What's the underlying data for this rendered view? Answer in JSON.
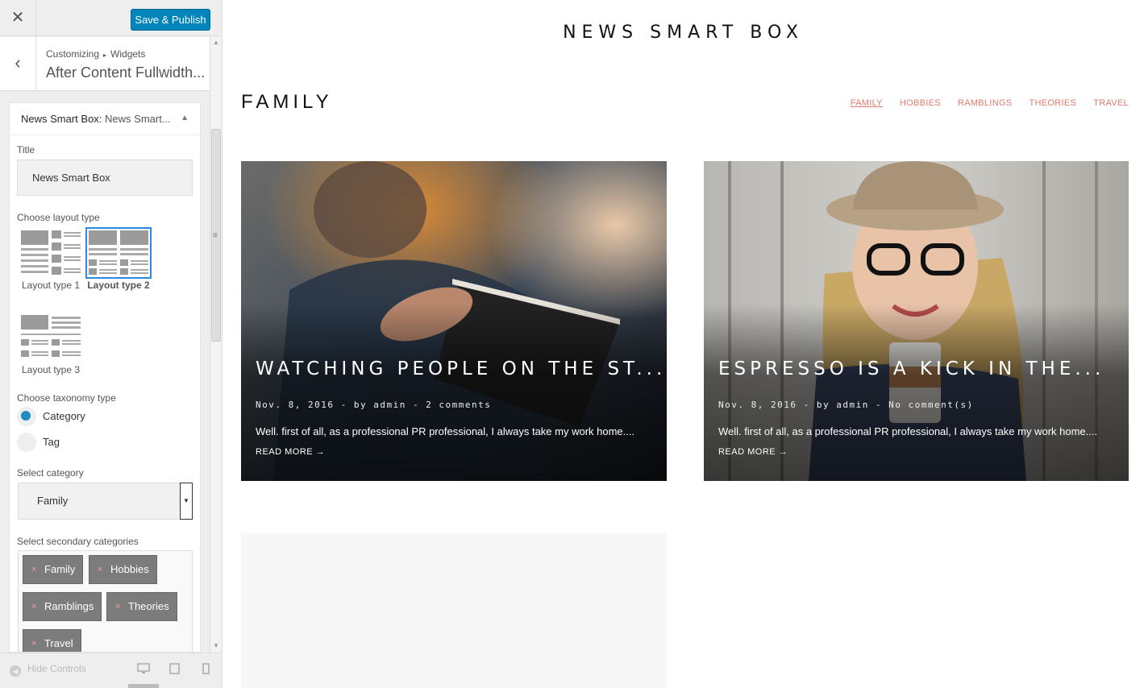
{
  "topbar": {
    "close_icon": "close-icon",
    "publish_label": "Save & Publish"
  },
  "section": {
    "breadcrumb_root": "Customizing",
    "breadcrumb_sep": "▸",
    "breadcrumb_current": "Widgets",
    "title": "After Content Fullwidth..."
  },
  "widget": {
    "title_strong": "News Smart Box:",
    "title_rest": "News Smart...",
    "title_label": "Title",
    "title_value": "News Smart Box",
    "layout_label": "Choose layout type",
    "layouts": [
      {
        "label": "Layout type 1",
        "selected": false
      },
      {
        "label": "Layout type 2",
        "selected": true
      },
      {
        "label": "Layout type 3",
        "selected": false
      }
    ],
    "taxonomy_label": "Choose taxonomy type",
    "taxonomy_options": [
      {
        "label": "Category",
        "checked": true
      },
      {
        "label": "Tag",
        "checked": false
      }
    ],
    "category_label": "Select category",
    "category_value": "Family",
    "secondary_label": "Select secondary categories",
    "secondary_chips": [
      "Family",
      "Hobbies",
      "Ramblings",
      "Theories",
      "Travel"
    ],
    "chip_remove": "×"
  },
  "footer": {
    "hide_controls": "Hide Controls"
  },
  "preview": {
    "site_title": "NEWS SMART BOX",
    "box_title": "FAMILY",
    "categories": [
      "FAMILY",
      "HOBBIES",
      "RAMBLINGS",
      "THEORIES",
      "TRAVEL"
    ],
    "posts": [
      {
        "title": "WATCHING PEOPLE ON THE ST...",
        "meta": "Nov. 8, 2016  -  by admin  -  2 comments",
        "excerpt": "Well. first of all, as a professional PR professional, I always take my work home....",
        "more": "READ MORE →"
      },
      {
        "title": "ESPRESSO IS A KICK IN THE...",
        "meta": "Nov. 8, 2016  -  by admin  -  No comment(s)",
        "excerpt": "Well. first of all, as a professional PR professional, I always take my work home....",
        "more": "READ MORE →"
      }
    ]
  },
  "colors": {
    "accent": "#0085ba",
    "nav_link": "#e07a6e",
    "radio": "#1e8cbe",
    "select_outline": "#2f88dd"
  }
}
